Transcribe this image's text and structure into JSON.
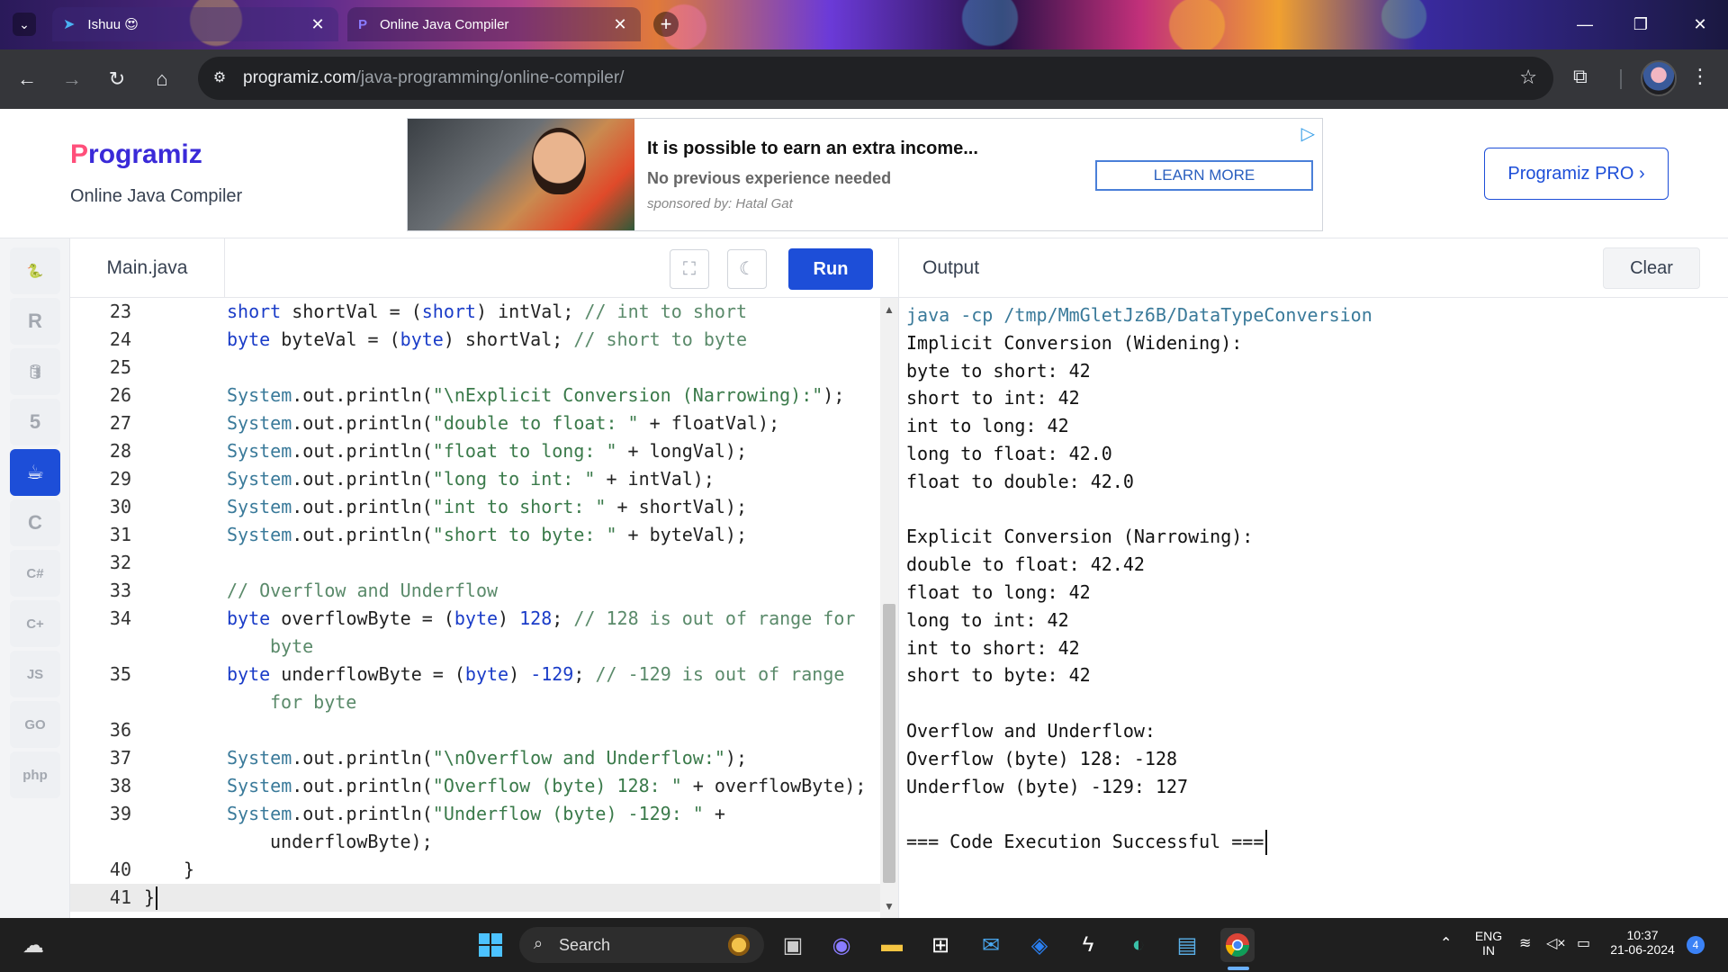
{
  "browser": {
    "tabs": [
      {
        "title": "Ishuu 😍",
        "active": false
      },
      {
        "title": "Online Java Compiler",
        "active": true
      }
    ],
    "url_host": "programiz.com",
    "url_path": "/java-programming/online-compiler/"
  },
  "site": {
    "logo_mark": "P",
    "logo_text": "rogramiz",
    "subtitle": "Online Java Compiler",
    "pro_button": "Programiz PRO ›"
  },
  "ad": {
    "headline": "It is possible to earn an extra income...",
    "subline": "No previous experience needed",
    "sponsor": "sponsored by: Hatal Gat",
    "cta": "LEARN MORE"
  },
  "languages": [
    {
      "name": "python-icon",
      "glyph": "🐍",
      "active": false
    },
    {
      "name": "r-icon",
      "glyph": "R",
      "active": false
    },
    {
      "name": "sql-icon",
      "glyph": "🛢",
      "active": false
    },
    {
      "name": "html-icon",
      "glyph": "5",
      "active": false
    },
    {
      "name": "java-icon",
      "glyph": "☕",
      "active": true
    },
    {
      "name": "c-icon",
      "glyph": "C",
      "active": false
    },
    {
      "name": "csharp-icon",
      "glyph": "C#",
      "active": false
    },
    {
      "name": "cpp-icon",
      "glyph": "C+",
      "active": false
    },
    {
      "name": "js-icon",
      "glyph": "JS",
      "active": false
    },
    {
      "name": "go-icon",
      "glyph": "GO",
      "active": false
    },
    {
      "name": "php-icon",
      "glyph": "php",
      "active": false
    }
  ],
  "editor": {
    "file_name": "Main.java",
    "run_label": "Run",
    "active_line": 41
  },
  "code_lines": [
    {
      "n": "23",
      "html": "<span class=\"kw\">short</span> shortVal = (<span class=\"kw\">short</span>) intVal; <span class=\"cmt\">// int to short</span>"
    },
    {
      "n": "24",
      "html": "<span class=\"kw\">byte</span> byteVal = (<span class=\"kw\">byte</span>) shortVal; <span class=\"cmt\">// short to byte</span>"
    },
    {
      "n": "25",
      "html": ""
    },
    {
      "n": "26",
      "html": "<span class=\"cls\">System</span>.out.println(<span class=\"str\">\"\\nExplicit Conversion (Narrowing):\"</span>);"
    },
    {
      "n": "27",
      "html": "<span class=\"cls\">System</span>.out.println(<span class=\"str\">\"double to float: \"</span> + floatVal);"
    },
    {
      "n": "28",
      "html": "<span class=\"cls\">System</span>.out.println(<span class=\"str\">\"float to long: \"</span> + longVal);"
    },
    {
      "n": "29",
      "html": "<span class=\"cls\">System</span>.out.println(<span class=\"str\">\"long to int: \"</span> + intVal);"
    },
    {
      "n": "30",
      "html": "<span class=\"cls\">System</span>.out.println(<span class=\"str\">\"int to short: \"</span> + shortVal);"
    },
    {
      "n": "31",
      "html": "<span class=\"cls\">System</span>.out.println(<span class=\"str\">\"short to byte: \"</span> + byteVal);"
    },
    {
      "n": "32",
      "html": ""
    },
    {
      "n": "33",
      "html": "<span class=\"cmt\">// Overflow and Underflow</span>"
    },
    {
      "n": "34",
      "html": "<span class=\"kw\">byte</span> overflowByte = (<span class=\"kw\">byte</span>) <span class=\"num\">128</span>; <span class=\"cmt\">// 128 is out of range for</span>"
    },
    {
      "n": "",
      "cont": true,
      "html": "<span class=\"cmt\">byte</span>"
    },
    {
      "n": "35",
      "html": "<span class=\"kw\">byte</span> underflowByte = (<span class=\"kw\">byte</span>) <span class=\"num\">-129</span>; <span class=\"cmt\">// -129 is out of range</span>"
    },
    {
      "n": "",
      "cont": true,
      "html": "<span class=\"cmt\">for byte</span>"
    },
    {
      "n": "36",
      "html": ""
    },
    {
      "n": "37",
      "html": "<span class=\"cls\">System</span>.out.println(<span class=\"str\">\"\\nOverflow and Underflow:\"</span>);"
    },
    {
      "n": "38",
      "html": "<span class=\"cls\">System</span>.out.println(<span class=\"str\">\"Overflow (byte) 128: \"</span> + overflowByte);"
    },
    {
      "n": "39",
      "html": "<span class=\"cls\">System</span>.out.println(<span class=\"str\">\"Underflow (byte) -129: \"</span> +"
    },
    {
      "n": "",
      "cont": true,
      "html": "underflowByte);"
    },
    {
      "n": "40",
      "indent": 1,
      "html": "}"
    },
    {
      "n": "41",
      "indent": 0,
      "html": "}"
    }
  ],
  "output": {
    "title": "Output",
    "clear_label": "Clear",
    "lines": [
      {
        "text": "java -cp /tmp/MmGletJz6B/DataTypeConversion",
        "cmd": true
      },
      {
        "text": "Implicit Conversion (Widening):"
      },
      {
        "text": "byte to short: 42"
      },
      {
        "text": "short to int: 42"
      },
      {
        "text": "int to long: 42"
      },
      {
        "text": "long to float: 42.0"
      },
      {
        "text": "float to double: 42.0"
      },
      {
        "text": ""
      },
      {
        "text": "Explicit Conversion (Narrowing):"
      },
      {
        "text": "double to float: 42.42"
      },
      {
        "text": "float to long: 42"
      },
      {
        "text": "long to int: 42"
      },
      {
        "text": "int to short: 42"
      },
      {
        "text": "short to byte: 42"
      },
      {
        "text": ""
      },
      {
        "text": "Overflow and Underflow:"
      },
      {
        "text": "Overflow (byte) 128: -128"
      },
      {
        "text": "Underflow (byte) -129: 127"
      },
      {
        "text": ""
      },
      {
        "text": "=== Code Execution Successful ==="
      }
    ]
  },
  "taskbar": {
    "search_label": "Search",
    "lang_top": "ENG",
    "lang_bottom": "IN",
    "time": "10:37",
    "date": "21-06-2024",
    "notification_count": "4"
  }
}
